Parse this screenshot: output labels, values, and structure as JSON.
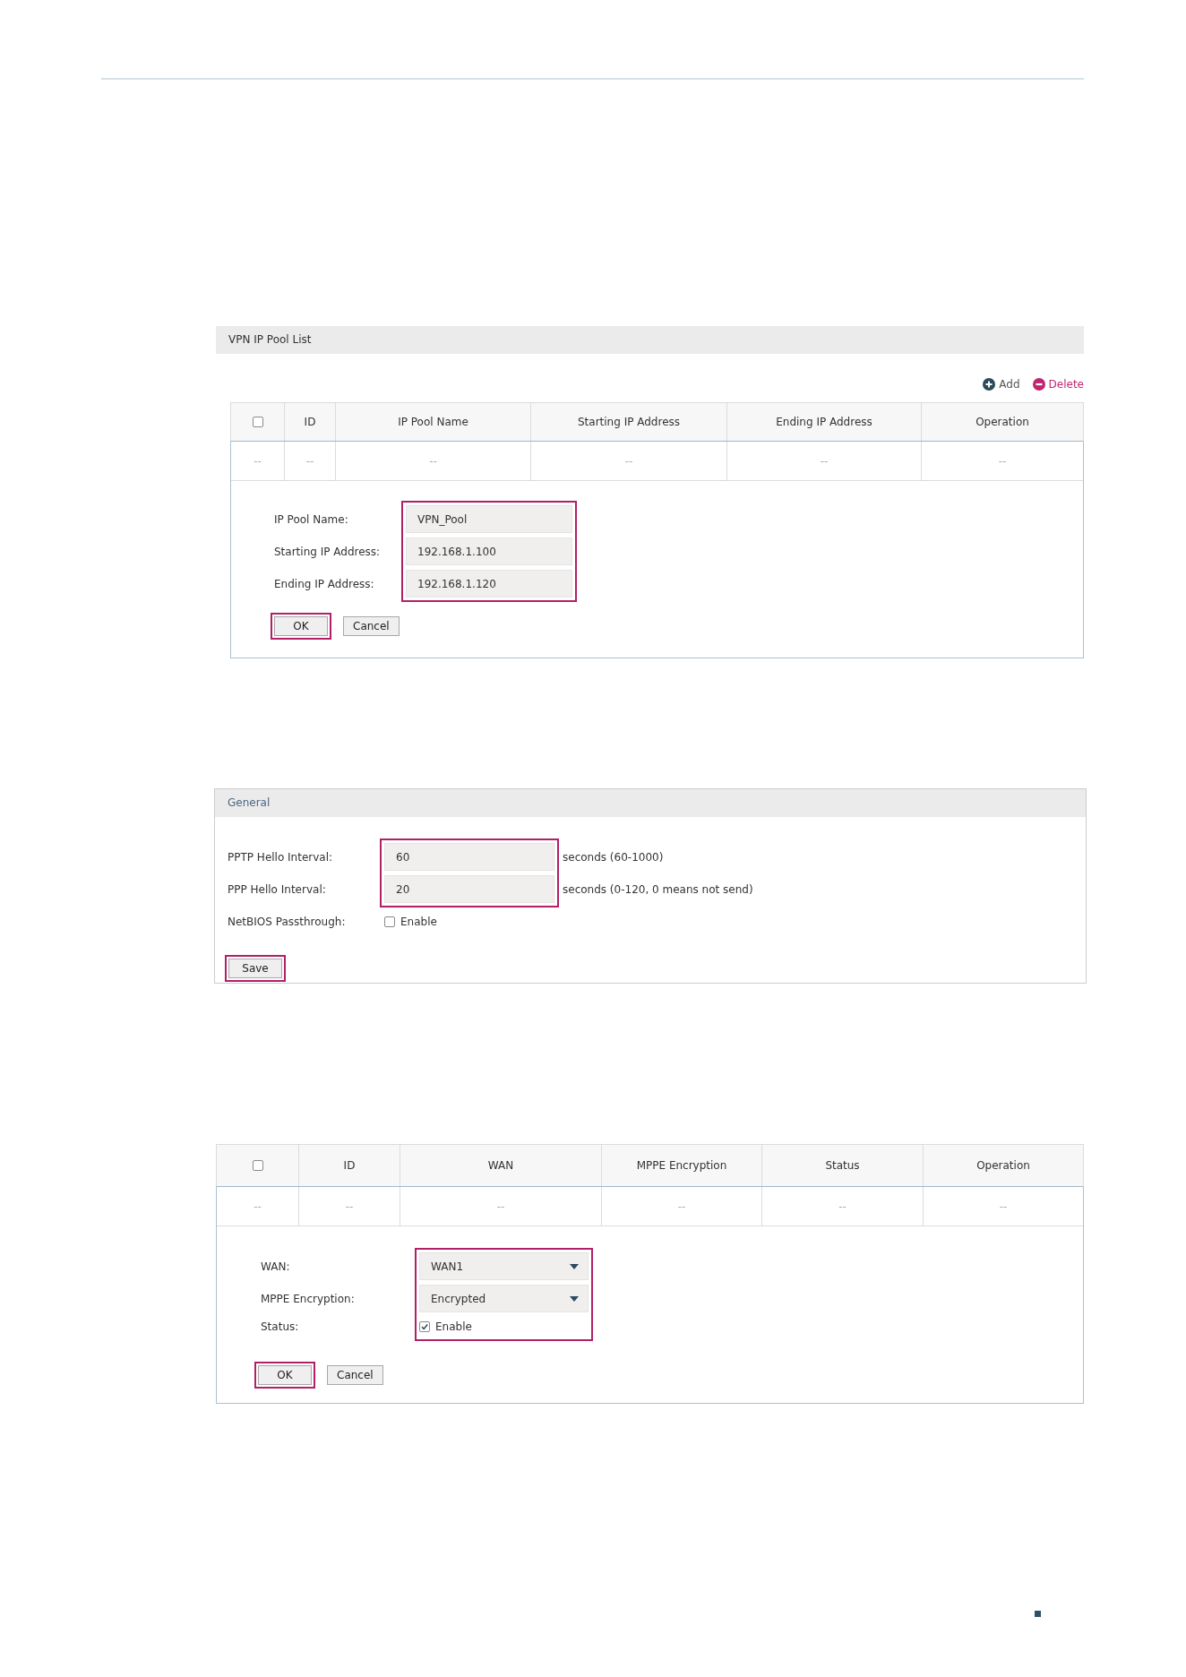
{
  "ip_pool_panel": {
    "title": "VPN IP Pool List",
    "actions": [
      {
        "kind": "add",
        "label": "Add"
      },
      {
        "kind": "delete",
        "label": "Delete"
      }
    ],
    "table": {
      "columns": [
        {
          "kind": "checkbox",
          "checked": false
        },
        {
          "kind": "text",
          "label": "ID"
        },
        {
          "kind": "text",
          "label": "IP Pool Name"
        },
        {
          "kind": "text",
          "label": "Starting IP Address"
        },
        {
          "kind": "text",
          "label": "Ending IP Address"
        },
        {
          "kind": "text",
          "label": "Operation"
        }
      ],
      "rows": [
        [
          "--",
          "--",
          "--",
          "--",
          "--",
          "--"
        ]
      ]
    },
    "form": {
      "fields": [
        {
          "kind": "input",
          "label": "IP Pool Name:",
          "value": "VPN_Pool",
          "highlighted": true
        },
        {
          "kind": "input",
          "label": "Starting IP Address:",
          "value": "192.168.1.100",
          "highlighted": true
        },
        {
          "kind": "input",
          "label": "Ending IP Address:",
          "value": "192.168.1.120",
          "highlighted": true
        }
      ],
      "buttons": [
        {
          "label": "OK",
          "highlighted": true
        },
        {
          "label": "Cancel",
          "highlighted": false
        }
      ]
    }
  },
  "general_panel": {
    "title": "General",
    "form": {
      "fields": [
        {
          "kind": "input",
          "label": "PPTP Hello Interval:",
          "value": "60",
          "hint": "seconds (60-1000)",
          "highlighted": true
        },
        {
          "kind": "input",
          "label": "PPP Hello Interval:",
          "value": "20",
          "hint": "seconds (0-120, 0 means not send)",
          "highlighted": true
        },
        {
          "kind": "checkbox",
          "label": "NetBIOS Passthrough:",
          "option": "Enable",
          "checked": false,
          "highlighted": false
        }
      ],
      "buttons": [
        {
          "label": "Save",
          "highlighted": true
        }
      ]
    }
  },
  "wan_list_panel": {
    "table": {
      "columns": [
        {
          "kind": "checkbox",
          "checked": false
        },
        {
          "kind": "text",
          "label": "ID"
        },
        {
          "kind": "text",
          "label": "WAN"
        },
        {
          "kind": "text",
          "label": "MPPE Encryption"
        },
        {
          "kind": "text",
          "label": "Status"
        },
        {
          "kind": "text",
          "label": "Operation"
        }
      ],
      "rows": [
        [
          "--",
          "--",
          "--",
          "--",
          "--",
          "--"
        ]
      ]
    },
    "form": {
      "fields": [
        {
          "kind": "select",
          "label": "WAN:",
          "value": "WAN1",
          "highlighted": true
        },
        {
          "kind": "select",
          "label": "MPPE Encryption:",
          "value": "Encrypted",
          "highlighted": true
        },
        {
          "kind": "checkbox",
          "label": "Status:",
          "option": "Enable",
          "checked": true,
          "highlighted": true
        }
      ],
      "buttons": [
        {
          "label": "OK",
          "highlighted": true
        },
        {
          "label": "Cancel",
          "highlighted": false
        }
      ]
    }
  }
}
